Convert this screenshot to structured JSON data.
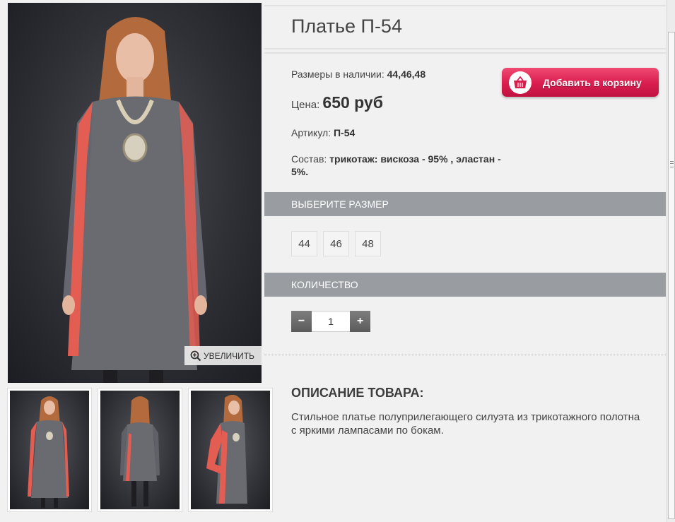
{
  "product": {
    "title": "Платье П-54",
    "sizes_label": "Размеры в наличии: ",
    "sizes_value": "44,46,48",
    "price_label": "Цена: ",
    "price_value": "650 руб",
    "sku_label": "Артикул: ",
    "sku_value": "П-54",
    "composition_label": "Состав: ",
    "composition_value": "трикотаж: вискоза - 95% , эластан - 5%."
  },
  "cart": {
    "add_label": "Добавить в корзину",
    "icon": "basket-icon"
  },
  "gallery": {
    "zoom_label": "УВЕЛИЧИТЬ",
    "zoom_icon": "magnifier-plus-icon"
  },
  "size_select": {
    "heading": "ВЫБЕРИТЕ РАЗМЕР",
    "options": [
      "44",
      "46",
      "48"
    ]
  },
  "quantity": {
    "heading": "КОЛИЧЕСТВО",
    "minus_label": "−",
    "plus_label": "+",
    "value": "1"
  },
  "description": {
    "heading": "ОПИСАНИЕ ТОВАРА:",
    "text": "Стильное платье полуприлегающего силуэта из трикотажного полотна с яркими лампасами по бокам."
  },
  "colors": {
    "accent": "#d91d4f",
    "section_bar": "#999da1",
    "dress_gray": "#6a6b70",
    "dress_stripe": "#e45d52"
  }
}
